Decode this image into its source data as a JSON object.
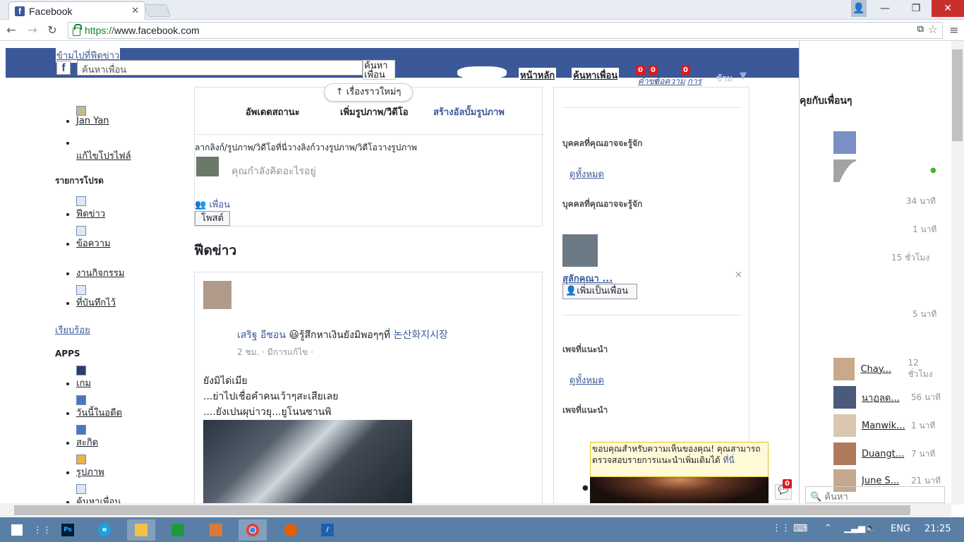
{
  "browser": {
    "tab_title": "Facebook",
    "url_scheme": "https://",
    "url_rest": "www.facebook.com",
    "accent": "#3b5998"
  },
  "header": {
    "skip_link": "ข้ามไปที่ฟีดข่าว",
    "search_placeholder": "ค้นหาเพื่อน",
    "search_button": "ค้นหาเพื่อน",
    "home": "หน้าหลัก",
    "find_friends": "ค้นหาเพื่อน",
    "friend_requests_badge": "0",
    "messages_badge": "0",
    "notifications_badge": "0",
    "friend_requests_label": "คำขอเป็นเพื่อน",
    "messages_label": "ข้อความ",
    "notifications_label": "การแจ้งเตือน",
    "privacy_label": "ข้าม"
  },
  "left_nav": {
    "user_name": "Jan Yan",
    "edit_profile": "แก้ไขโปรไฟล์",
    "favorites_heading": "รายการโปรด",
    "favorites": [
      {
        "label": "ฟีดข่าว"
      },
      {
        "label": "ข้อความ"
      },
      {
        "label": "งานกิจกรรม"
      },
      {
        "label": "ที่บันทึกไว้"
      }
    ],
    "done": "เรียบร้อย",
    "apps_heading": "APPS",
    "apps": [
      {
        "label": "เกม"
      },
      {
        "label": "วันนี้ในอดีต"
      },
      {
        "label": "สะกิด"
      },
      {
        "label": "รูปภาพ"
      },
      {
        "label": "ค้นหาเพื่อน"
      }
    ]
  },
  "composer": {
    "tab_status": "อัพเดตสถานะ",
    "tab_photo": "เพิ่มรูปภาพ/วิดีโอ",
    "tab_album": "สร้างอัลบั้มรูปภาพ",
    "new_stories": "เรื่องราวใหม่ๆ",
    "drop_hint": "ลากลิงก์/รูปภาพ/วิดีโอที่นี่วางลิงก์วางรูปภาพ/วิดีโอวางรูปภาพ",
    "placeholder": "คุณกำลังคิดอะไรอยู่",
    "audience": "เพื่อน",
    "post_button": "โพสต์"
  },
  "feed": {
    "title": "ฟีดข่าว",
    "post": {
      "author": "เสริฐ อีชอน",
      "feeling": "รู้สึกหาเงินยังมิพอๆๆที่",
      "place": "논산화지시장",
      "time": "2 ชม.",
      "edited": "มีการแก้ไข",
      "line1": "ยังมิได่เมีย",
      "line2": "...ย่าไปเชื่อคำคนเว้าๆสะเสียเลย",
      "line3": "....ยังเปนผุบ่าวยุ...ยูโนนซานพิ"
    }
  },
  "right_col": {
    "pymk1": "บุคคลที่คุณอาจจะรู้จัก",
    "see_all1": "ดูทั้งหมด",
    "pymk2": "บุคคลที่คุณอาจจะรู้จัก",
    "suggest_name": "สุลักคณา ...",
    "add_friend": "เพิ่มเป็นเพื่อน",
    "close": "×",
    "pages1": "เพจที่แนะนำ",
    "see_all2": "ดูทั้งหมด",
    "pages2": "เพจที่แนะนำ",
    "thanks": "ขอบคุณสำหรับความเห็นของคุณ! คุณสามารถตรวจสอบรายการแนะนำเพิ่มเติมได้",
    "thanks_link": "ที่นี่"
  },
  "chat": {
    "heading": "คุยกับเพื่อนๆ",
    "rows": [
      {
        "name": "Chay...",
        "time": "12 ชั่วโมง"
      },
      {
        "name": "นาฏลด...",
        "time": "56 นาที"
      },
      {
        "name": "Manwik...",
        "time": "1 นาที"
      },
      {
        "name": "Duangt...",
        "time": "7 นาที"
      },
      {
        "name": "June S...",
        "time": "21 นาที"
      }
    ],
    "top_times": [
      "34 นาที",
      "1 นาที",
      "15 ชั่วโมง",
      "",
      "5 นาที"
    ],
    "search_placeholder": "ค้นหา",
    "badge": "0"
  },
  "taskbar": {
    "lang": "ENG",
    "clock": "21:25"
  }
}
